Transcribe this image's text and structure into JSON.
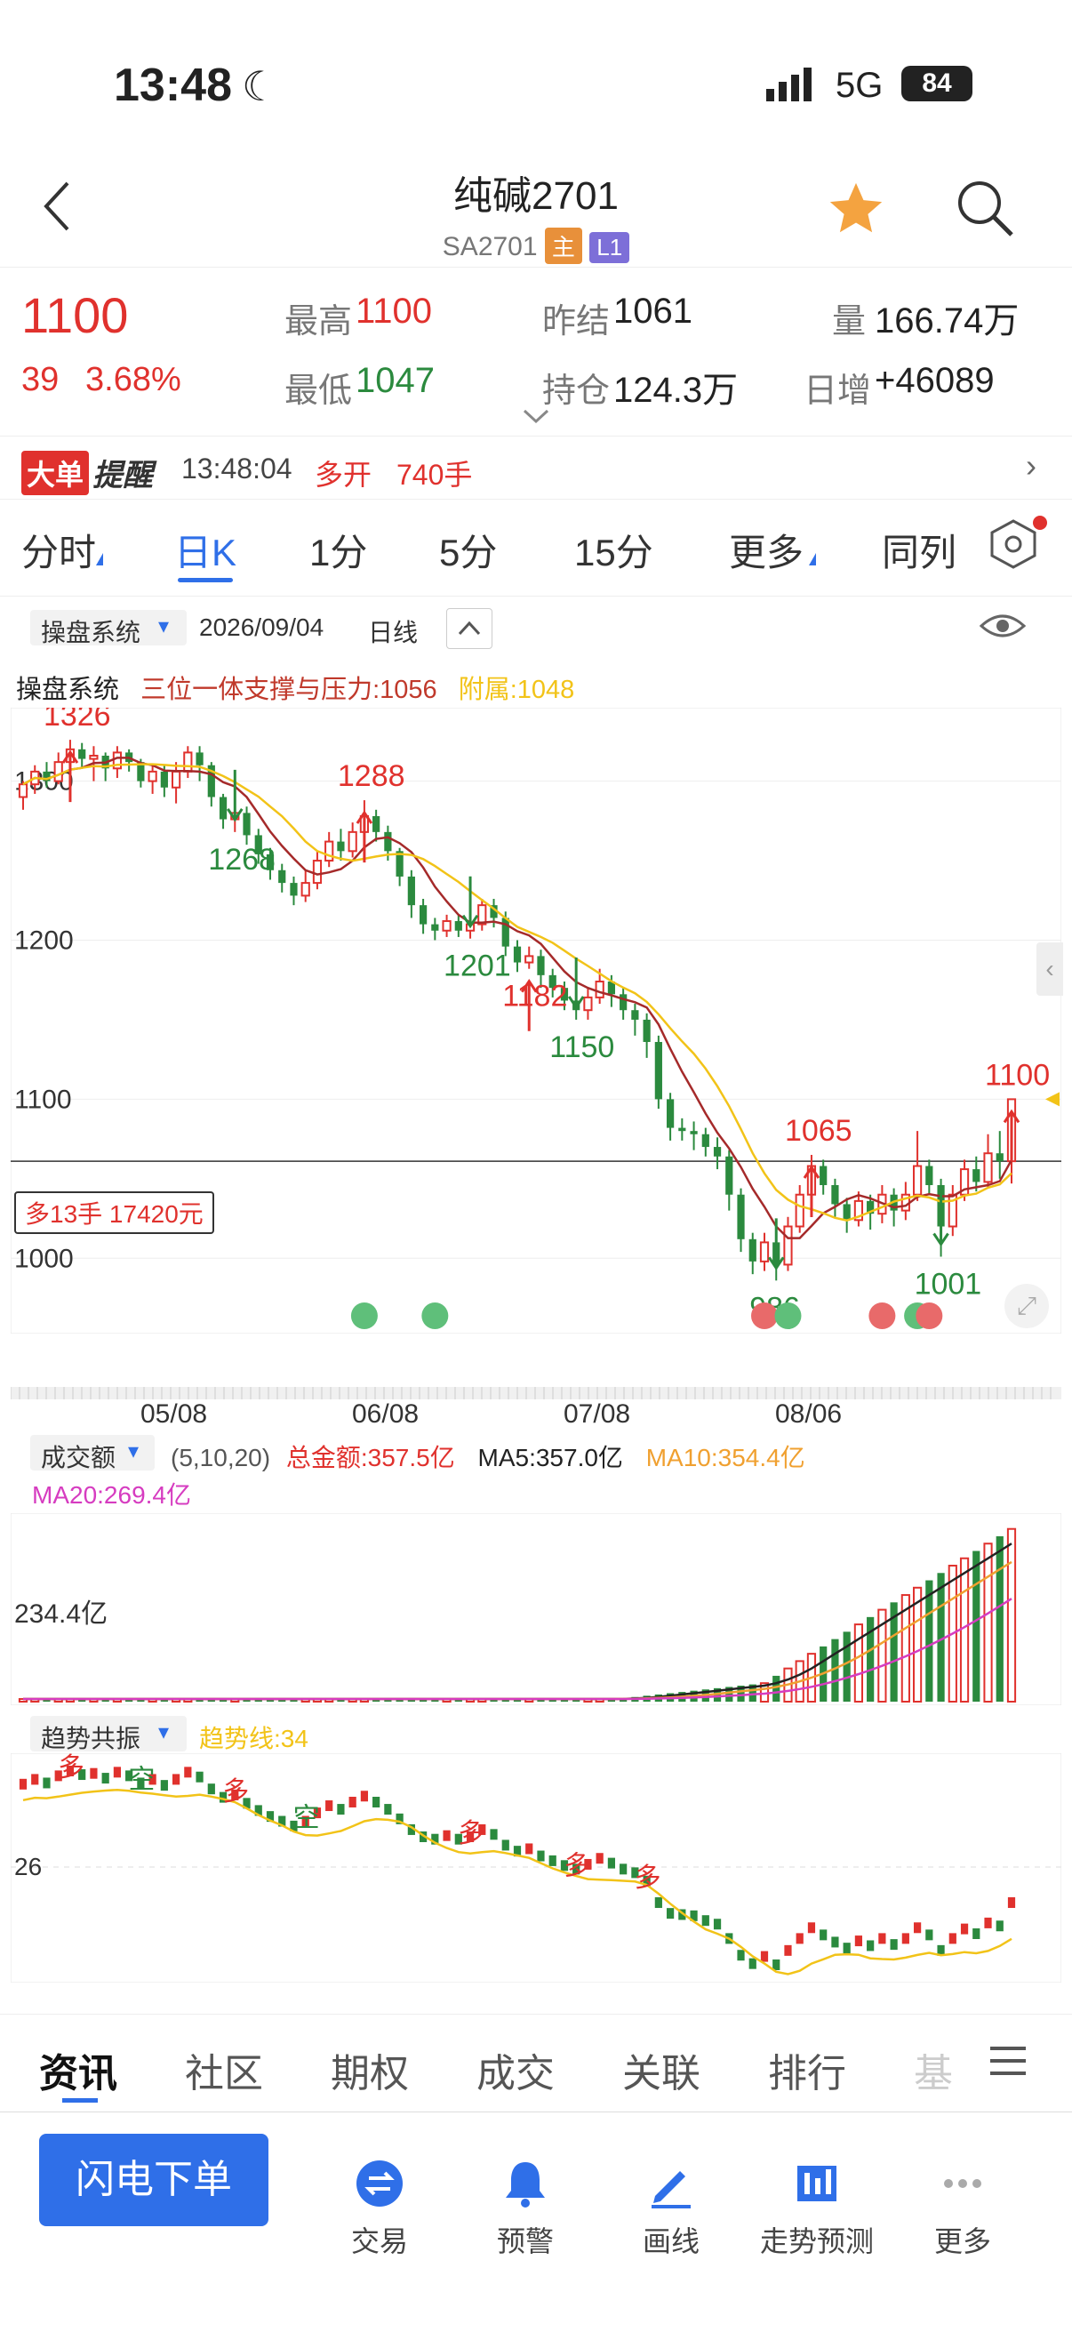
{
  "status": {
    "time": "13:48",
    "network": "5G",
    "battery": "84"
  },
  "nav": {
    "title": "纯碱2701",
    "code": "SA2701",
    "badge_main": "主",
    "badge_level": "L1"
  },
  "quote": {
    "price": "1100",
    "change": "39",
    "change_pct": "3.68%",
    "high_label": "最高",
    "high": "1100",
    "low_label": "最低",
    "low": "1047",
    "prev_label": "昨结",
    "prev": "1061",
    "oi_label": "持仓",
    "oi": "124.3万",
    "vol_label": "量",
    "vol": "166.74万",
    "inc_label": "日增",
    "inc": "+46089"
  },
  "alert": {
    "tag1": "大单",
    "tag2": "提醒",
    "time": "13:48:04",
    "action": "多开",
    "lots": "740手"
  },
  "tabs": [
    "分时",
    "日K",
    "1分",
    "5分",
    "15分",
    "更多",
    "同列"
  ],
  "chart_header": {
    "system": "操盘系统",
    "date": "2026/09/04",
    "period": "日线"
  },
  "legend": {
    "system": "操盘系统",
    "item1": "三位一体支撑与压力:1056",
    "item2": "附属:1048"
  },
  "volume_header": {
    "name": "成交额",
    "params": "(5,10,20)",
    "total": "总金额:357.5亿",
    "ma5": "MA5:357.0亿",
    "ma10": "MA10:354.4亿",
    "ma20": "MA20:269.4亿",
    "axis": "234.4亿"
  },
  "trend_header": {
    "name": "趋势共振",
    "line": "趋势线:34",
    "axis": "26"
  },
  "position_label": "多13手 17420元",
  "colors": {
    "up": "#e0312d",
    "down": "#2b8a3e",
    "ma_yellow": "#f2c318",
    "ma_red": "#a52a2a",
    "accent": "#2f6fe8"
  },
  "chart_data": {
    "type": "candlestick",
    "y_ticks": [
      "1300",
      "1200",
      "1100",
      "1000"
    ],
    "ylim": [
      975,
      1335
    ],
    "x_labels": [
      "05/08",
      "06/08",
      "07/08",
      "08/06"
    ],
    "candles": [
      [
        1290,
        1298,
        1282,
        1300
      ],
      [
        1298,
        1306,
        1292,
        1310
      ],
      [
        1306,
        1300,
        1296,
        1312
      ],
      [
        1300,
        1312,
        1298,
        1318
      ],
      [
        1312,
        1320,
        1306,
        1326
      ],
      [
        1320,
        1314,
        1308,
        1324
      ],
      [
        1314,
        1316,
        1300,
        1322
      ],
      [
        1316,
        1308,
        1300,
        1318
      ],
      [
        1308,
        1318,
        1302,
        1322
      ],
      [
        1318,
        1312,
        1306,
        1320
      ],
      [
        1312,
        1300,
        1296,
        1314
      ],
      [
        1300,
        1306,
        1292,
        1310
      ],
      [
        1306,
        1296,
        1290,
        1310
      ],
      [
        1296,
        1306,
        1286,
        1312
      ],
      [
        1306,
        1318,
        1302,
        1322
      ],
      [
        1318,
        1310,
        1300,
        1322
      ],
      [
        1310,
        1290,
        1284,
        1312
      ],
      [
        1290,
        1276,
        1270,
        1292
      ],
      [
        1276,
        1280,
        1268,
        1286
      ],
      [
        1280,
        1266,
        1260,
        1284
      ],
      [
        1266,
        1254,
        1248,
        1270
      ],
      [
        1254,
        1244,
        1238,
        1258
      ],
      [
        1244,
        1236,
        1230,
        1248
      ],
      [
        1236,
        1228,
        1222,
        1240
      ],
      [
        1228,
        1236,
        1224,
        1244
      ],
      [
        1236,
        1250,
        1232,
        1256
      ],
      [
        1250,
        1262,
        1246,
        1268
      ],
      [
        1262,
        1256,
        1250,
        1270
      ],
      [
        1256,
        1268,
        1252,
        1274
      ],
      [
        1268,
        1278,
        1262,
        1288
      ],
      [
        1278,
        1268,
        1262,
        1282
      ],
      [
        1268,
        1256,
        1250,
        1272
      ],
      [
        1256,
        1240,
        1234,
        1258
      ],
      [
        1240,
        1222,
        1214,
        1244
      ],
      [
        1222,
        1210,
        1204,
        1226
      ],
      [
        1210,
        1206,
        1200,
        1214
      ],
      [
        1206,
        1212,
        1202,
        1216
      ],
      [
        1212,
        1206,
        1202,
        1216
      ],
      [
        1206,
        1210,
        1201,
        1214
      ],
      [
        1210,
        1222,
        1206,
        1226
      ],
      [
        1222,
        1214,
        1208,
        1226
      ],
      [
        1214,
        1196,
        1190,
        1218
      ],
      [
        1196,
        1186,
        1180,
        1200
      ],
      [
        1186,
        1190,
        1182,
        1196
      ],
      [
        1190,
        1178,
        1170,
        1194
      ],
      [
        1178,
        1170,
        1164,
        1182
      ],
      [
        1170,
        1162,
        1156,
        1174
      ],
      [
        1162,
        1156,
        1150,
        1166
      ],
      [
        1156,
        1164,
        1150,
        1170
      ],
      [
        1164,
        1174,
        1160,
        1182
      ],
      [
        1174,
        1166,
        1158,
        1178
      ],
      [
        1166,
        1156,
        1150,
        1170
      ],
      [
        1156,
        1150,
        1140,
        1160
      ],
      [
        1150,
        1136,
        1126,
        1154
      ],
      [
        1136,
        1100,
        1094,
        1140
      ],
      [
        1100,
        1082,
        1074,
        1104
      ],
      [
        1082,
        1080,
        1074,
        1088
      ],
      [
        1080,
        1078,
        1068,
        1086
      ],
      [
        1078,
        1070,
        1064,
        1082
      ],
      [
        1070,
        1064,
        1056,
        1076
      ],
      [
        1064,
        1040,
        1030,
        1068
      ],
      [
        1040,
        1012,
        1004,
        1044
      ],
      [
        1012,
        998,
        990,
        1016
      ],
      [
        998,
        1010,
        992,
        1016
      ],
      [
        1010,
        996,
        986,
        1014
      ],
      [
        996,
        1020,
        992,
        1026
      ],
      [
        1020,
        1040,
        1016,
        1046
      ],
      [
        1040,
        1058,
        1036,
        1065
      ],
      [
        1058,
        1046,
        1040,
        1062
      ],
      [
        1046,
        1034,
        1026,
        1050
      ],
      [
        1034,
        1024,
        1016,
        1038
      ],
      [
        1024,
        1036,
        1020,
        1042
      ],
      [
        1036,
        1028,
        1018,
        1040
      ],
      [
        1028,
        1040,
        1022,
        1046
      ],
      [
        1040,
        1030,
        1020,
        1044
      ],
      [
        1030,
        1040,
        1024,
        1048
      ],
      [
        1040,
        1058,
        1036,
        1080
      ],
      [
        1058,
        1046,
        1040,
        1062
      ],
      [
        1046,
        1020,
        1001,
        1050
      ],
      [
        1020,
        1040,
        1014,
        1046
      ],
      [
        1040,
        1056,
        1036,
        1062
      ],
      [
        1056,
        1048,
        1042,
        1064
      ],
      [
        1048,
        1066,
        1044,
        1078
      ],
      [
        1066,
        1061,
        1050,
        1080
      ],
      [
        1061,
        1100,
        1047,
        1100
      ]
    ],
    "annotations": [
      {
        "text": "1326",
        "color": "up"
      },
      {
        "text": "1268",
        "color": "down"
      },
      {
        "text": "1288",
        "color": "up"
      },
      {
        "text": "1201",
        "color": "down"
      },
      {
        "text": "1182",
        "color": "up"
      },
      {
        "text": "1150",
        "color": "down"
      },
      {
        "text": "1065",
        "color": "up"
      },
      {
        "text": "986",
        "color": "down"
      },
      {
        "text": "1100",
        "color": "up"
      },
      {
        "text": "1001",
        "color": "down"
      }
    ],
    "trend_labels": [
      "多",
      "空",
      "多",
      "空",
      "多",
      "多",
      "多"
    ]
  },
  "bottom_tabs": [
    "资讯",
    "社区",
    "期权",
    "成交",
    "关联",
    "排行",
    "基"
  ],
  "toolbar": {
    "primary": "闪电下单",
    "items": [
      "交易",
      "预警",
      "画线",
      "走势预测",
      "更多"
    ]
  }
}
